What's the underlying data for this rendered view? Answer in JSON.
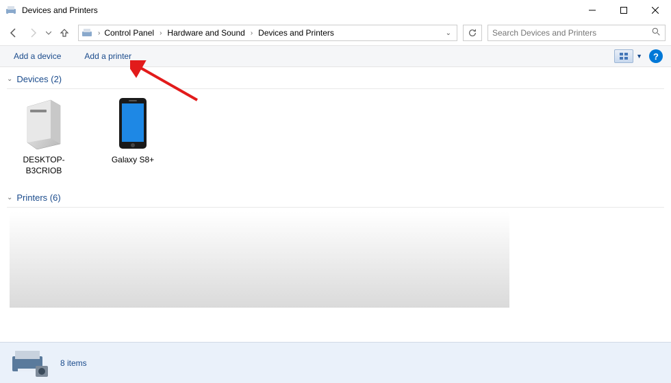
{
  "window": {
    "title": "Devices and Printers"
  },
  "breadcrumb": {
    "items": [
      "Control Panel",
      "Hardware and Sound",
      "Devices and Printers"
    ]
  },
  "search": {
    "placeholder": "Search Devices and Printers"
  },
  "toolbar": {
    "add_device": "Add a device",
    "add_printer": "Add a printer"
  },
  "groups": {
    "devices": {
      "title": "Devices (2)",
      "count": 2
    },
    "printers": {
      "title": "Printers (6)",
      "count": 6
    }
  },
  "devices": [
    {
      "name": "DESKTOP-B3CRIOB",
      "kind": "pc"
    },
    {
      "name": "Galaxy S8+",
      "kind": "phone"
    }
  ],
  "statusbar": {
    "item_count": "8 items"
  }
}
